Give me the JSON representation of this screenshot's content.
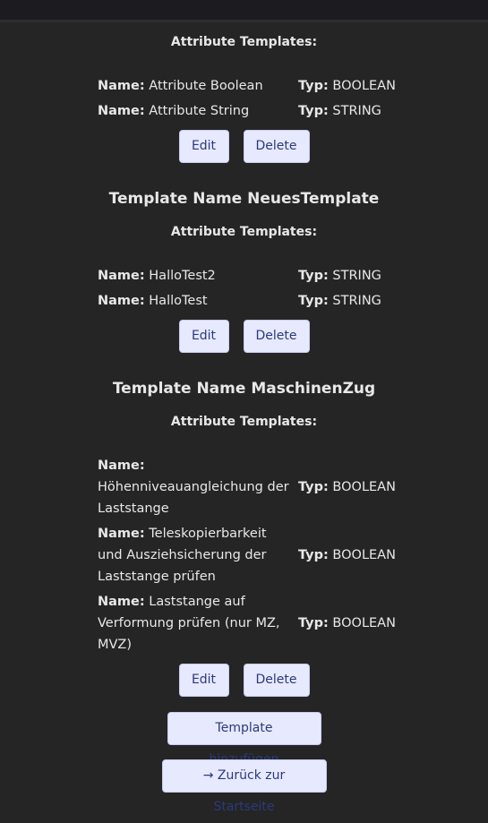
{
  "sections": [
    {
      "title": "",
      "attr_heading": "Attribute Templates:",
      "attributes": [
        {
          "name_label": "Name:",
          "name": "Attribute Boolean",
          "typ_label": "Typ:",
          "typ": "BOOLEAN"
        },
        {
          "name_label": "Name:",
          "name": "Attribute String",
          "typ_label": "Typ:",
          "typ": "STRING"
        }
      ],
      "edit_label": "Edit",
      "delete_label": "Delete"
    },
    {
      "title": "Template Name NeuesTemplate",
      "attr_heading": "Attribute Templates:",
      "attributes": [
        {
          "name_label": "Name:",
          "name": "HalloTest2",
          "typ_label": "Typ:",
          "typ": "STRING"
        },
        {
          "name_label": "Name:",
          "name": "HalloTest",
          "typ_label": "Typ:",
          "typ": "STRING"
        }
      ],
      "edit_label": "Edit",
      "delete_label": "Delete"
    },
    {
      "title": "Template Name MaschinenZug",
      "attr_heading": "Attribute Templates:",
      "attributes": [
        {
          "name_label": "Name:",
          "name": "Höhenniveauangleichung der Laststange",
          "typ_label": "Typ:",
          "typ": "BOOLEAN"
        },
        {
          "name_label": "Name:",
          "name": "Teleskopierbarkeit und Ausziehsicherung der Laststange prüfen",
          "typ_label": "Typ:",
          "typ": "BOOLEAN"
        },
        {
          "name_label": "Name:",
          "name": "Laststange auf Verformung prüfen (nur MZ, MVZ)",
          "typ_label": "Typ:",
          "typ": "BOOLEAN"
        }
      ],
      "edit_label": "Edit",
      "delete_label": "Delete"
    }
  ],
  "add_template_label": "Template hinzufügen",
  "back_label": "→ Zurück zur Startseite"
}
